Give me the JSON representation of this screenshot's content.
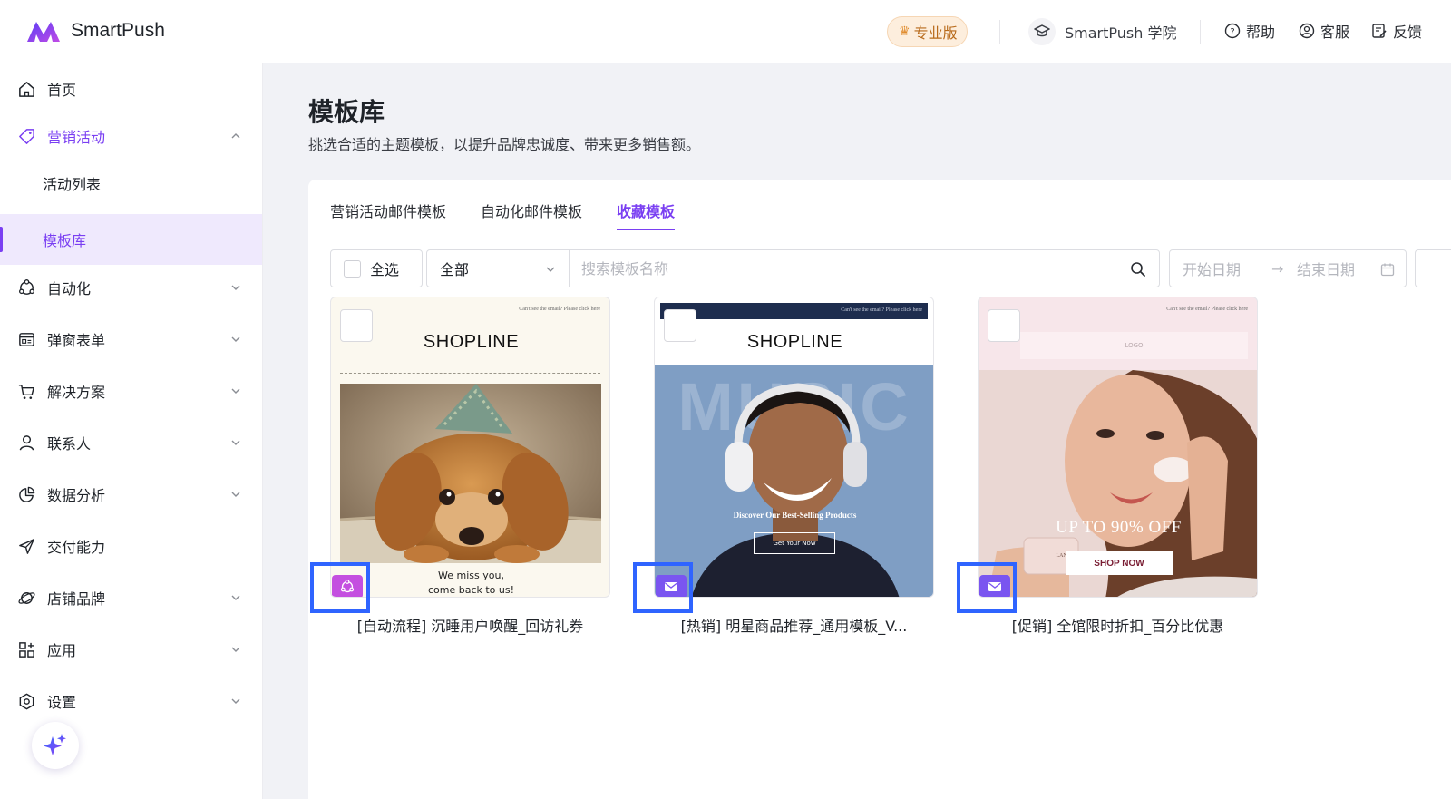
{
  "header": {
    "brand": "SmartPush",
    "plan_badge": "专业版",
    "academy": "SmartPush 学院",
    "help": "帮助",
    "support": "客服",
    "feedback": "反馈"
  },
  "sidebar": {
    "items": [
      {
        "label": "首页",
        "icon": "home-icon"
      },
      {
        "label": "营销活动",
        "icon": "tag-icon"
      },
      {
        "label": "活动列表"
      },
      {
        "label": "模板库"
      },
      {
        "label": "自动化",
        "icon": "automation-icon"
      },
      {
        "label": "弹窗表单",
        "icon": "form-icon"
      },
      {
        "label": "解决方案",
        "icon": "cart-icon"
      },
      {
        "label": "联系人",
        "icon": "person-icon"
      },
      {
        "label": "数据分析",
        "icon": "pie-chart-icon"
      },
      {
        "label": "交付能力",
        "icon": "send-icon"
      },
      {
        "label": "店铺品牌",
        "icon": "planet-icon"
      },
      {
        "label": "应用",
        "icon": "apps-icon"
      },
      {
        "label": "设置",
        "icon": "settings-icon"
      }
    ]
  },
  "page": {
    "title": "模板库",
    "subtitle": "挑选合适的主题模板，以提升品牌忠诚度、带来更多销售额。"
  },
  "tabs": [
    {
      "label": "营销活动邮件模板"
    },
    {
      "label": "自动化邮件模板"
    },
    {
      "label": "收藏模板"
    }
  ],
  "filters": {
    "select_all": "全选",
    "type_value": "全部",
    "search_placeholder": "搜索模板名称",
    "start_date": "开始日期",
    "end_date": "结束日期",
    "arrow": "→"
  },
  "cards": [
    {
      "name": "[自动流程] 沉睡用户唤醒_回访礼券",
      "header_fine": "Can't see the email? Please click here",
      "brand": "SHOPLINE",
      "caption_line1": "We miss you,",
      "caption_line2": "come back to us!"
    },
    {
      "name": "[热销] 明星商品推荐_通用模板_V...",
      "header_fine": "Can't see the email? Please click here",
      "brand": "SHOPLINE",
      "bg_word": "MUSIC",
      "headline": "Discover Our Best-Selling Products",
      "cta": "Get Your Now"
    },
    {
      "name": "[促销] 全馆限时折扣_百分比优惠",
      "header_fine": "Can't see the email? Please click here",
      "logo": "LOGO",
      "headline": "UP TO 90% OFF",
      "cta": "SHOP NOW",
      "product_label": "LANDO"
    }
  ],
  "colors": {
    "accent": "#7a3ff2",
    "highlight": "#2f64ff",
    "automation_tag": "#c44fe0",
    "email_tag": "#7a55f0"
  }
}
